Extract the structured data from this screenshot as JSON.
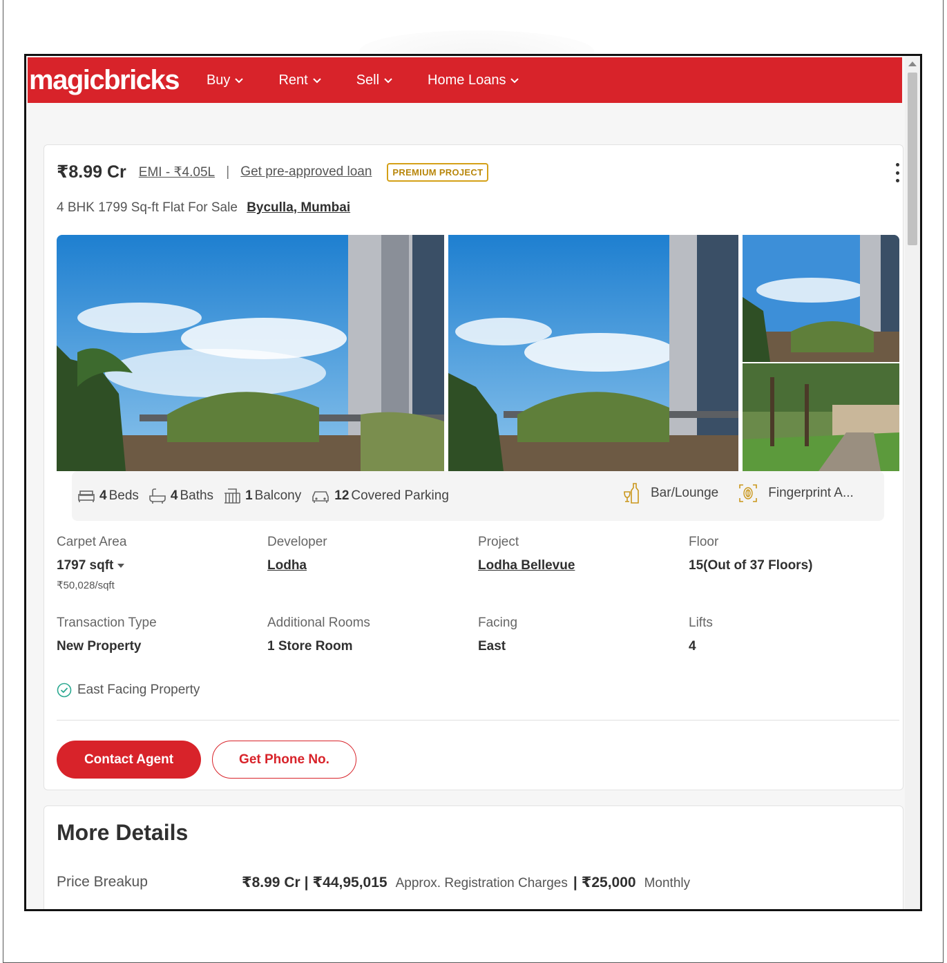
{
  "nav": {
    "logo": "magicbricks",
    "items": [
      "Buy",
      "Rent",
      "Sell",
      "Home Loans"
    ]
  },
  "listing": {
    "price": "₹8.99 Cr",
    "emi": "EMI - ₹4.05L",
    "separator": "|",
    "loan_link": "Get pre-approved loan",
    "badge": "PREMIUM PROJECT",
    "title": "4 BHK 1799 Sq-ft Flat For Sale",
    "location": "Byculla, Mumbai"
  },
  "amenities": {
    "beds_count": "4",
    "beds_label": "Beds",
    "baths_count": "4",
    "baths_label": "Baths",
    "balcony_count": "1",
    "balcony_label": "Balcony",
    "parking_count": "12",
    "parking_label": "Covered Parking",
    "bar": "Bar/Lounge",
    "fingerprint": "Fingerprint A..."
  },
  "details": [
    {
      "label": "Carpet Area",
      "value": "1797 sqft",
      "sub": "₹50,028/sqft"
    },
    {
      "label": "Developer",
      "value": "Lodha"
    },
    {
      "label": "Project",
      "value": "Lodha Bellevue"
    },
    {
      "label": "Floor",
      "value": "15(Out of 37 Floors)"
    },
    {
      "label": "Transaction Type",
      "value": "New Property"
    },
    {
      "label": "Additional Rooms",
      "value": "1 Store Room"
    },
    {
      "label": "Facing",
      "value": "East"
    },
    {
      "label": "Lifts",
      "value": "4"
    }
  ],
  "feature": "East Facing Property",
  "buttons": {
    "contact": "Contact Agent",
    "phone": "Get Phone No."
  },
  "more_details": {
    "title": "More Details",
    "price_breakup_label": "Price Breakup",
    "price": "₹8.99 Cr",
    "pipe": "|",
    "registration_amount": "₹44,95,015",
    "registration_label": "Approx. Registration Charges",
    "monthly_amount": "₹25,000",
    "monthly_label": "Monthly"
  },
  "colors": {
    "brand_red": "#d8232a",
    "premium_gold": "#d4a017",
    "check_teal": "#2aa890"
  }
}
